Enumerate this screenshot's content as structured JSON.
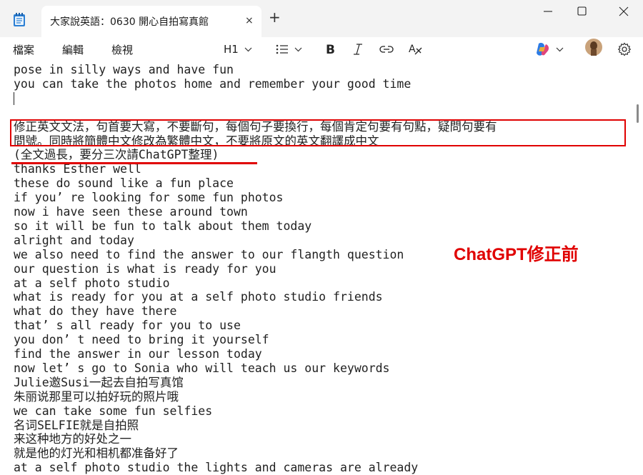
{
  "window": {
    "tab_title": "大家說英語：0630 開心自拍寫真館",
    "tab_close_icon": "×",
    "new_tab_icon": "+",
    "minimize_icon": "minimize-icon",
    "maximize_icon": "maximize-icon",
    "close_icon": "close-icon"
  },
  "menu": {
    "file": "檔案",
    "edit": "編輯",
    "view": "檢視"
  },
  "toolbar": {
    "heading": "H1",
    "list_icon": "bullet-list-icon",
    "bold_icon": "bold-icon",
    "italic_icon": "italic-icon",
    "link_icon": "link-icon",
    "clear_format_icon": "clear-format-icon",
    "copilot_icon": "copilot-icon",
    "avatar_icon": "avatar-icon",
    "settings_icon": "gear-icon"
  },
  "colors": {
    "accent_red": "#e00000",
    "text": "#1f1f1f",
    "titlebar": "#f3f3f3"
  },
  "callout": "ChatGPT修正前",
  "lines": [
    "pose in silly ways and have fun",
    "you can take the photos home and remember your good time",
    "",
    "",
    "修正英文文法，句首要大寫，不要斷句，每個句子要換行，每個肯定句要有句點，疑問句要有",
    "問號。同時將簡體中文修改為繁體中文，不要將原文的英文翻譯成中文",
    "(全文過長，要分三次請ChatGPT整理)",
    "thanks Esther well",
    "these do sound like a fun place",
    "if you’ re looking for some fun photos",
    "now i have seen these around town",
    "so it will be fun to talk about them today",
    "alright and today",
    "we also need to find the answer to our flangth question",
    "our question is what is ready for you",
    "at a self photo studio",
    "what is ready for you at a self photo studio friends",
    "what do they have there",
    "that’ s all ready for you to use",
    "you don’ t need to bring it yourself",
    "find the answer in our lesson today",
    "now let’ s go to Sonia who will teach us our keywords",
    "Julie邀Susi一起去自拍写真馆",
    "朱丽说那里可以拍好玩的照片哦",
    "we can take some fun selfies",
    "名词SELFIE就是自拍照",
    "来这种地方的好处之一",
    "就是他的灯光和相机都准备好了",
    "at a self photo studio the lights and cameras are already"
  ]
}
